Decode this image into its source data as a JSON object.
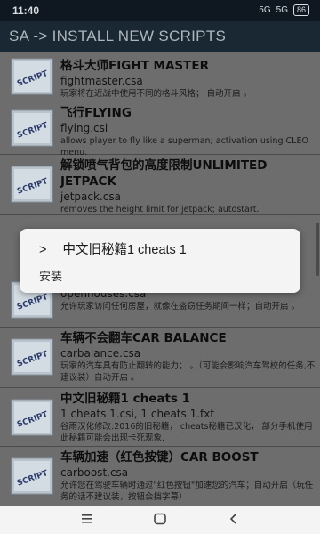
{
  "status_bar": {
    "time": "11:40",
    "signal1": "5G",
    "signal2": "5G",
    "battery": "86"
  },
  "app_bar": {
    "title": "SA -> INSTALL NEW SCRIPTS"
  },
  "thumbnail_label": "SCRIPT",
  "items": [
    {
      "title": "格斗大师FIGHT MASTER",
      "file": "fightmaster.csa",
      "desc": "玩家将在近战中使用不同的格斗风格； 自动开启 。"
    },
    {
      "title": "飞行FLYING",
      "file": "flying.csi",
      "desc": "allows player to fly like a superman; activation using CLEO menu."
    },
    {
      "title": "解锁喷气背包的高度限制UNLIMITED JETPACK",
      "file": "jetpack.csa",
      "desc": "removes the height limit for jetpack; autostart."
    },
    {
      "title": "",
      "file": "openhouses.csa",
      "desc": "允许玩家访问任何房屋，就像在盗窃任务期间一样；自动开启 。"
    },
    {
      "title": "车辆不会翻车CAR BALANCE",
      "file": "carbalance.csa",
      "desc": "玩家的汽车具有防止翻转的能力； 。（可能会影响汽车驾校的任务,不建议装）自动开启 。"
    },
    {
      "title": "中文旧秘籍1 cheats 1",
      "file": "1 cheats 1.csi, 1 cheats 1.fxt",
      "desc": "谷雨汉化修改:2016的旧秘籍， cheats秘籍已汉化， 部分手机使用此秘籍可能会出现卡死现象."
    },
    {
      "title": "车辆加速（红色按键）CAR BOOST",
      "file": "carboost.csa",
      "desc": "允许您在驾驶车辆时通过\"红色按钮\"加速您的汽车；自动开启（玩任务的话不建议装，按钮会挡字幕）"
    }
  ],
  "dialog": {
    "marker": ">",
    "title": "中文旧秘籍1 cheats 1",
    "option": "安装"
  },
  "nav_bar": {
    "menu": "menu-icon",
    "home": "home-icon",
    "back": "back-icon"
  }
}
